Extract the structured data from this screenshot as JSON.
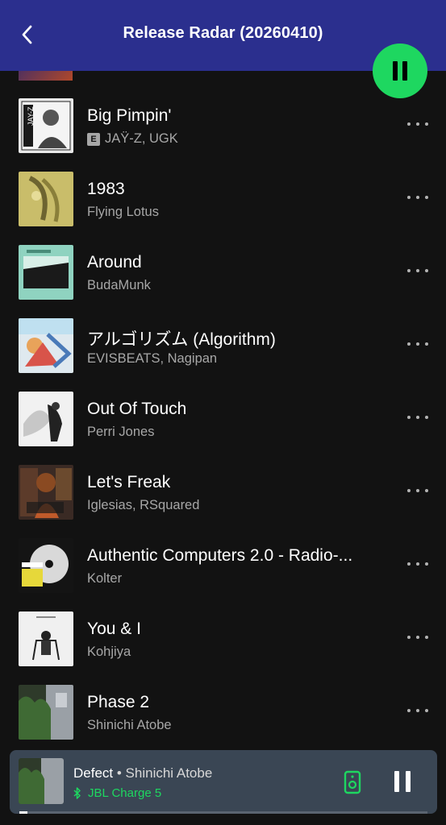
{
  "header": {
    "title": "Release Radar (20260410)",
    "bg_color": "#2b2f8e",
    "back_icon": "chevron-left-icon"
  },
  "play_button": {
    "state": "playing",
    "icon": "pause-icon",
    "color": "#1ed760"
  },
  "tracks": [
    {
      "title": "Big Pimpin'",
      "artist": "JAŸ-Z, UGK",
      "explicit": true,
      "explicit_label": "E"
    },
    {
      "title": "1983",
      "artist": "Flying Lotus",
      "explicit": false
    },
    {
      "title": "Around",
      "artist": "BudaMunk",
      "explicit": false
    },
    {
      "title": "アルゴリズム (Algorithm)",
      "artist": "EVISBEATS, Nagipan",
      "explicit": false
    },
    {
      "title": "Out Of Touch",
      "artist": "Perri Jones",
      "explicit": false
    },
    {
      "title": "Let's Freak",
      "artist": "Iglesias, RSquared",
      "explicit": false
    },
    {
      "title": "Authentic Computers 2.0 - Radio-...",
      "artist": "Kolter",
      "explicit": false
    },
    {
      "title": "You & I",
      "artist": "Kohjiya",
      "explicit": false
    },
    {
      "title": "Phase 2",
      "artist": "Shinichi Atobe",
      "explicit": false
    }
  ],
  "now_playing": {
    "title": "Defect",
    "separator": " • ",
    "artist": "Shinichi Atobe",
    "device": "JBL Charge 5",
    "device_icon": "bluetooth-icon",
    "progress": 0.02,
    "accent": "#1ed760"
  }
}
